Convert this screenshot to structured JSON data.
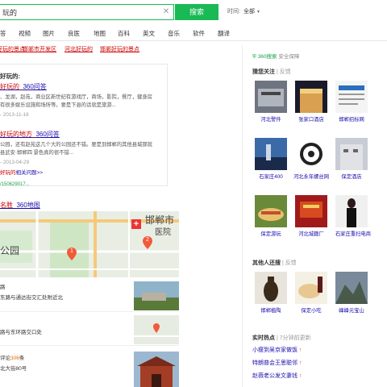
{
  "search": {
    "query": "玩的",
    "button_label": "搜索",
    "time_label": "时间:",
    "time_value": "全部"
  },
  "tabs": [
    "答",
    "视频",
    "图片",
    "良医",
    "地图",
    "百科",
    "英文",
    "音乐",
    "软件",
    "翻译"
  ],
  "related_links": [
    "邯郸好玩的景点",
    "邯郸市开发区",
    "河北好玩的",
    "邯郸好玩的景点"
  ],
  "qa_card": {
    "title": "好玩的:",
    "item1": {
      "link_prefix": "好玩的_",
      "link_suffix": "360问答",
      "line1": "、龙湖，赵苑，商业区新世纪有游戏厅，商场，影院，餐厅，健身房",
      "line2": "有很多娱乐设施和场所等。要是下县的话就是旅游...",
      "date": "- 2013-11-16"
    },
    "item2": {
      "link_prefix": "好玩的地方_",
      "link_suffix": "360问答",
      "line1": "公园，还有赵苑这几个大的公园还不错。要是到邯郸的其他县城那就",
      "line2": "县武安·邯郸四 景色真的很不错...",
      "date": "- 2013-04-29"
    },
    "more_prefix": "好玩的",
    "more_suffix": "相关问题>>",
    "url": "/150629017..."
  },
  "map": {
    "title_prefix": "名胜",
    "title_suffix": "_360地图",
    "labels": {
      "city": "邯郸市",
      "hospital": "医院",
      "park": "公园"
    },
    "markers": [
      "1",
      "2"
    ]
  },
  "pois": [
    {
      "line1": "路",
      "line2": "东路与通达街交汇处附近北"
    },
    {
      "line1": "路与东环路交口处",
      "line2": ""
    },
    {
      "line1_prefix": "评论",
      "count": "306",
      "line1_suffix": "条",
      "line2": "北大街80号"
    }
  ],
  "side": {
    "safe_label": "360搜索",
    "safe_suffix": "安全保障",
    "guess_title": "猜您关注",
    "feedback": "| 反馈",
    "guess_items": [
      {
        "caption": "河北警件"
      },
      {
        "caption": "张家口酒店"
      },
      {
        "caption": "邯郸招标网"
      },
      {
        "caption": "石家庄400"
      },
      {
        "caption": "河北永年螺丝网"
      },
      {
        "caption": "保定酒店"
      },
      {
        "caption": "保定游玩"
      },
      {
        "caption": "河北城籍厂"
      },
      {
        "caption": "石家庄重扫电商"
      }
    ],
    "others_title": "其他人还搜",
    "others_items": [
      {
        "caption": "邯郸植陶"
      },
      {
        "caption": "保定小吃"
      },
      {
        "caption": "峰峰元宝山"
      }
    ],
    "hot_title": "实时热点",
    "hot_time": "| 7分钟前更新",
    "hot_items": [
      "小瘦到吴京家做饭",
      "特朗普会王思聪邻",
      "赵薇老公发文妻钱"
    ]
  }
}
